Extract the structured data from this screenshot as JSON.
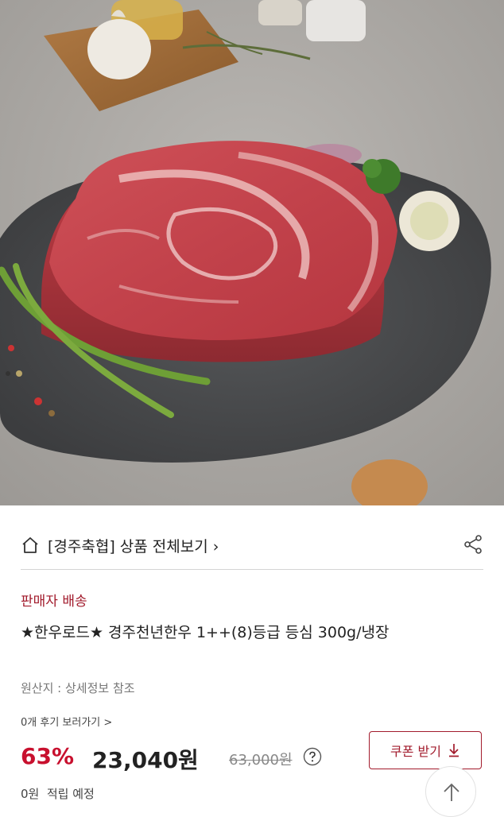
{
  "store": {
    "link_text": "[경주축협] 상품 전체보기",
    "chevron": "›"
  },
  "product": {
    "seller_type": "판매자 배송",
    "title": "★한우로드★ 경주천년한우 1++(8)등급 등심 300g/냉장",
    "origin": "원산지 : 상세정보 참조",
    "review_link": "0개 후기 보러가기 >"
  },
  "pricing": {
    "discount": "63%",
    "price": "23,040원",
    "original_price": "63,000원"
  },
  "coupon": {
    "label": "쿠폰 받기"
  },
  "points": {
    "text": "0원  적립 예정"
  },
  "icons": {
    "home": "home-icon",
    "share": "share-icon",
    "help": "question-icon",
    "download": "download-arrow-icon",
    "scroll_top": "arrow-up-icon"
  },
  "colors": {
    "accent": "#a21b2c",
    "discount": "#c8102e"
  }
}
